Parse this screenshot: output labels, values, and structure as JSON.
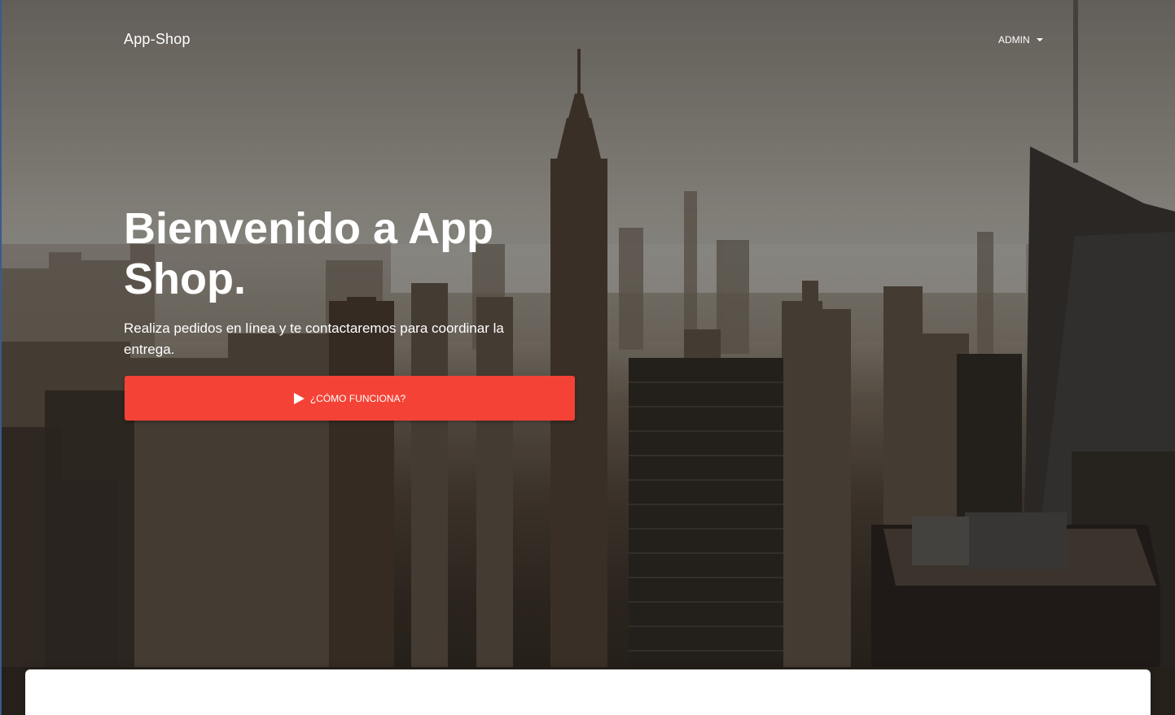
{
  "navbar": {
    "brand": "App-Shop",
    "user_menu_label": "ADMIN",
    "user_menu_icon": "caret-down-icon"
  },
  "hero": {
    "title": "Bienvenido a App Shop.",
    "description": "Realiza pedidos en línea y te contactaremos para coordinar la entrega.",
    "cta_label": "¿CÓMO FUNCIONA?",
    "cta_icon": "play-icon",
    "background_image": "city-skyline-photo"
  },
  "colors": {
    "accent": "#f44336",
    "text_on_hero": "#ffffff",
    "card_background": "#ffffff"
  }
}
